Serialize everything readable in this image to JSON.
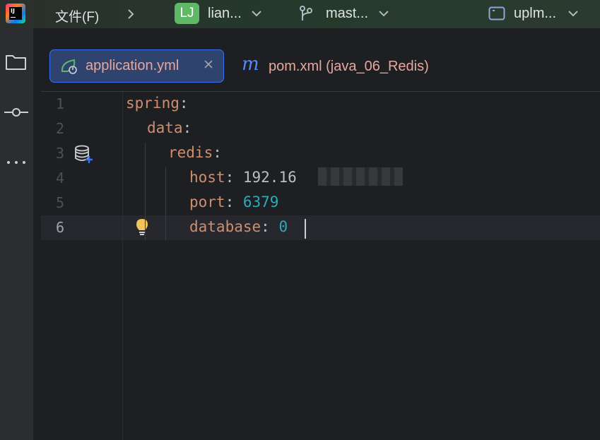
{
  "titlebar": {
    "menu_file": "文件(F)",
    "project_initials": "LJ",
    "project_name": "lian...",
    "branch_name": "mast...",
    "run_config": "uplm..."
  },
  "tabs": [
    {
      "label": "application.yml",
      "active": true,
      "icon": "spring-boot-config-icon"
    },
    {
      "label": "pom.xml (java_06_Redis)",
      "active": false,
      "icon": "maven-icon",
      "icon_glyph": "m"
    }
  ],
  "editor": {
    "line_numbers": [
      "1",
      "2",
      "3",
      "4",
      "5",
      "6"
    ],
    "current_line": 6,
    "lines": [
      {
        "key": "spring",
        "sep": ":",
        "value": ""
      },
      {
        "key": "data",
        "sep": ":",
        "value": ""
      },
      {
        "key": "redis",
        "sep": ":",
        "value": ""
      },
      {
        "key": "host",
        "sep": ": ",
        "value": "192.16"
      },
      {
        "key": "port",
        "sep": ": ",
        "value": "6379"
      },
      {
        "key": "database",
        "sep": ": ",
        "value": "0"
      }
    ]
  },
  "colors": {
    "key": "#cf8e6d",
    "number": "#2aacb8",
    "text": "#bcbec4",
    "active_tab_bg": "#2e436e",
    "active_tab_border": "#3574f0"
  }
}
